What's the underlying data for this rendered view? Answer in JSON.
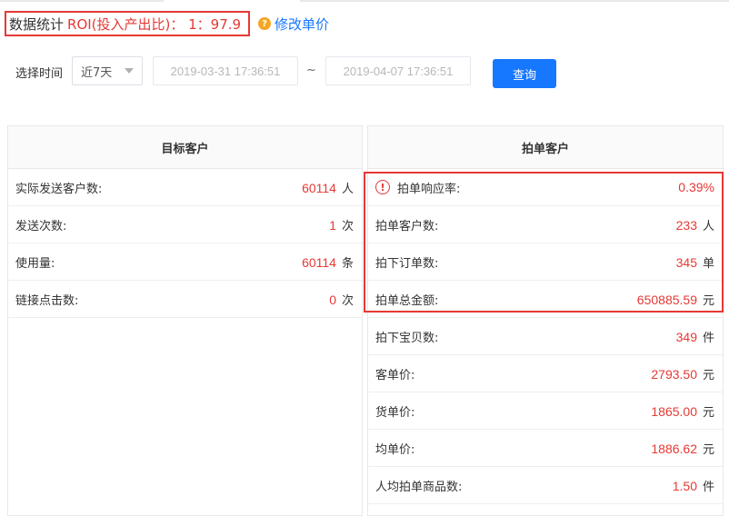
{
  "header": {
    "title": "数据统计",
    "roi_text": "ROI(投入产出比)：  1：97.9",
    "help_icon": "question-circle-icon",
    "edit_link": "修改单价"
  },
  "filter": {
    "label": "选择时间",
    "range_selected": "近7天",
    "start_date": "2019-03-31 17:36:51",
    "separator": "~",
    "end_date": "2019-04-07 17:36:51",
    "query_button": "查询"
  },
  "target_panel": {
    "title": "目标客户",
    "rows": [
      {
        "label": "实际发送客户数:",
        "value": "60114",
        "unit": "人"
      },
      {
        "label": "发送次数:",
        "value": "1",
        "unit": "次"
      },
      {
        "label": "使用量:",
        "value": "60114",
        "unit": "条"
      },
      {
        "label": "链接点击数:",
        "value": "0",
        "unit": "次"
      }
    ]
  },
  "order_panel": {
    "title": "拍单客户",
    "rows": [
      {
        "label": "拍单响应率:",
        "value": "0.39%",
        "unit": "",
        "warning_icon": "exclamation-circle-icon"
      },
      {
        "label": "拍单客户数:",
        "value": "233",
        "unit": "人"
      },
      {
        "label": "拍下订单数:",
        "value": "345",
        "unit": "单"
      },
      {
        "label": "拍单总金额:",
        "value": "650885.59",
        "unit": "元"
      },
      {
        "label": "拍下宝贝数:",
        "value": "349",
        "unit": "件"
      },
      {
        "label": "客单价:",
        "value": "2793.50",
        "unit": "元"
      },
      {
        "label": "货单价:",
        "value": "1865.00",
        "unit": "元"
      },
      {
        "label": "均单价:",
        "value": "1886.62",
        "unit": "元"
      },
      {
        "label": "人均拍单商品数:",
        "value": "1.50",
        "unit": "件"
      }
    ]
  },
  "colors": {
    "accent_blue": "#1677ff",
    "value_red": "#e53935",
    "help_orange": "#f5a623"
  }
}
